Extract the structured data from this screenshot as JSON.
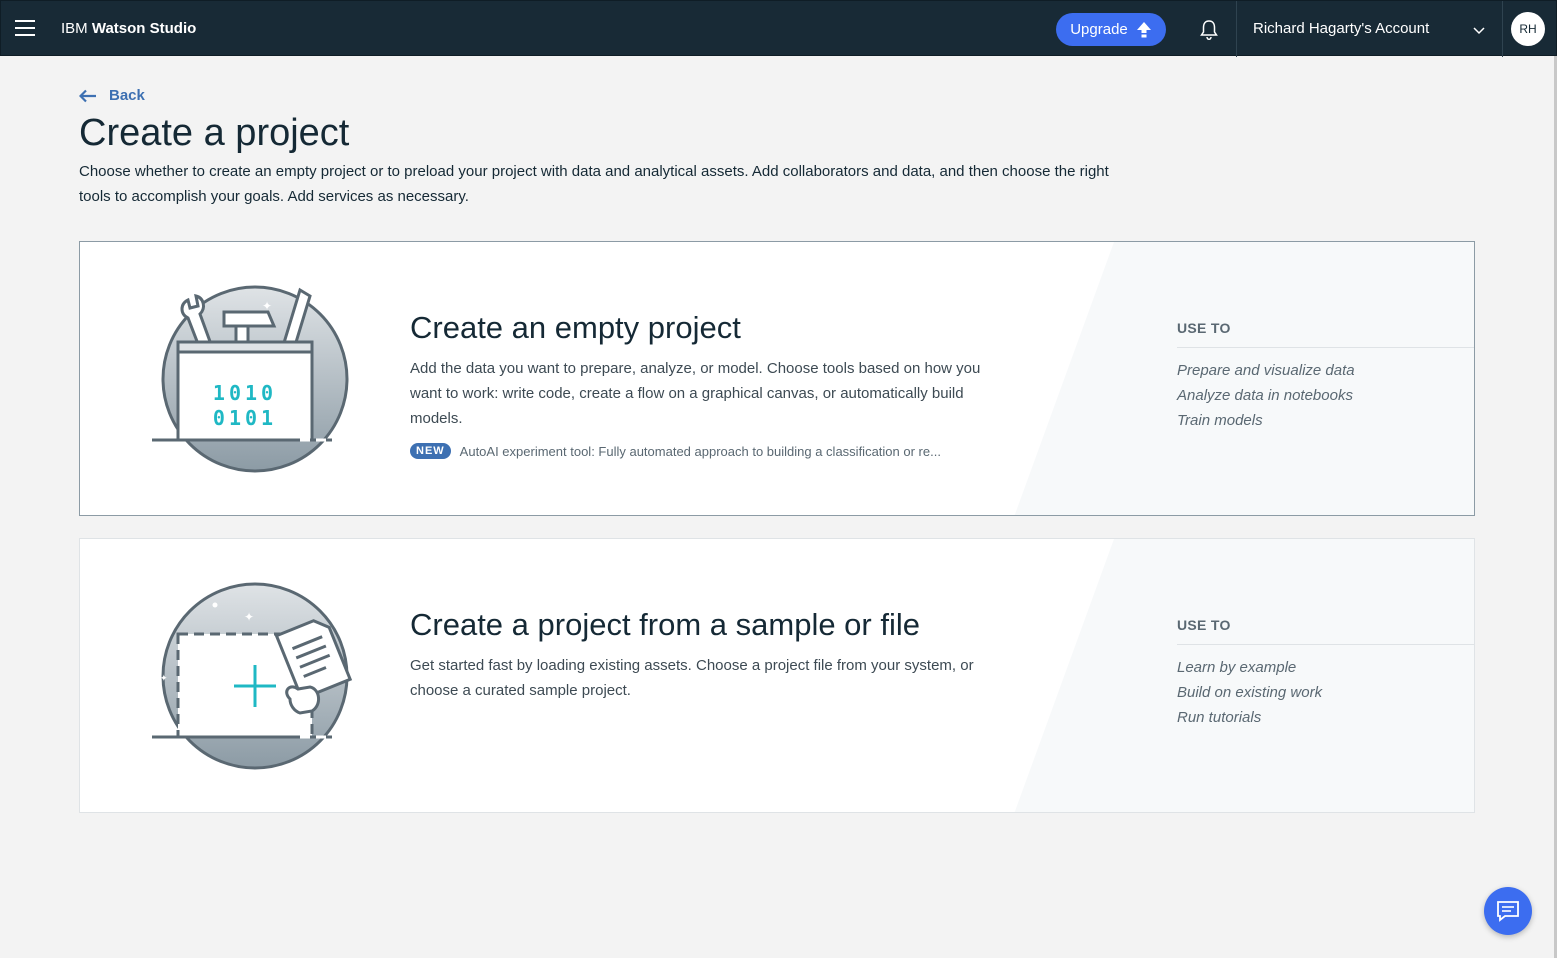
{
  "nav": {
    "brand_prefix": "IBM",
    "brand_name": "Watson Studio",
    "upgrade_label": "Upgrade",
    "account_label": "Richard Hagarty's Account",
    "avatar_initials": "RH"
  },
  "page": {
    "back_label": "Back",
    "title": "Create a project",
    "description": "Choose whether to create an empty project or to preload your project with data and analytical assets. Add collaborators and data, and then choose the right tools to accomplish your goals. Add services as necessary."
  },
  "cards": [
    {
      "title": "Create an empty project",
      "description": "Add the data you want to prepare, analyze, or model. Choose tools based on how you want to work: write code, create a flow on a graphical canvas, or automatically build models.",
      "badge": "NEW",
      "new_text": "AutoAI experiment tool: Fully automated approach to building a classification or re...",
      "illus_line1": "1010",
      "illus_line2": "0101",
      "use_to_heading": "USE TO",
      "use_to": [
        "Prepare and visualize data",
        "Analyze data in notebooks",
        "Train models"
      ]
    },
    {
      "title": "Create a project from a sample or file",
      "description": "Get started fast by loading existing assets. Choose a project file from your system, or choose a curated sample project.",
      "use_to_heading": "USE TO",
      "use_to": [
        "Learn by example",
        "Build on existing work",
        "Run tutorials"
      ]
    }
  ],
  "colors": {
    "nav_bg": "#182a36",
    "accent_blue": "#3c6df0",
    "link_blue": "#3d70b2",
    "teal": "#1fb8c4"
  },
  "icons": [
    "hamburger-icon",
    "upload-arrow-icon",
    "bell-icon",
    "chevron-down-icon",
    "arrow-left-icon",
    "chat-icon"
  ]
}
